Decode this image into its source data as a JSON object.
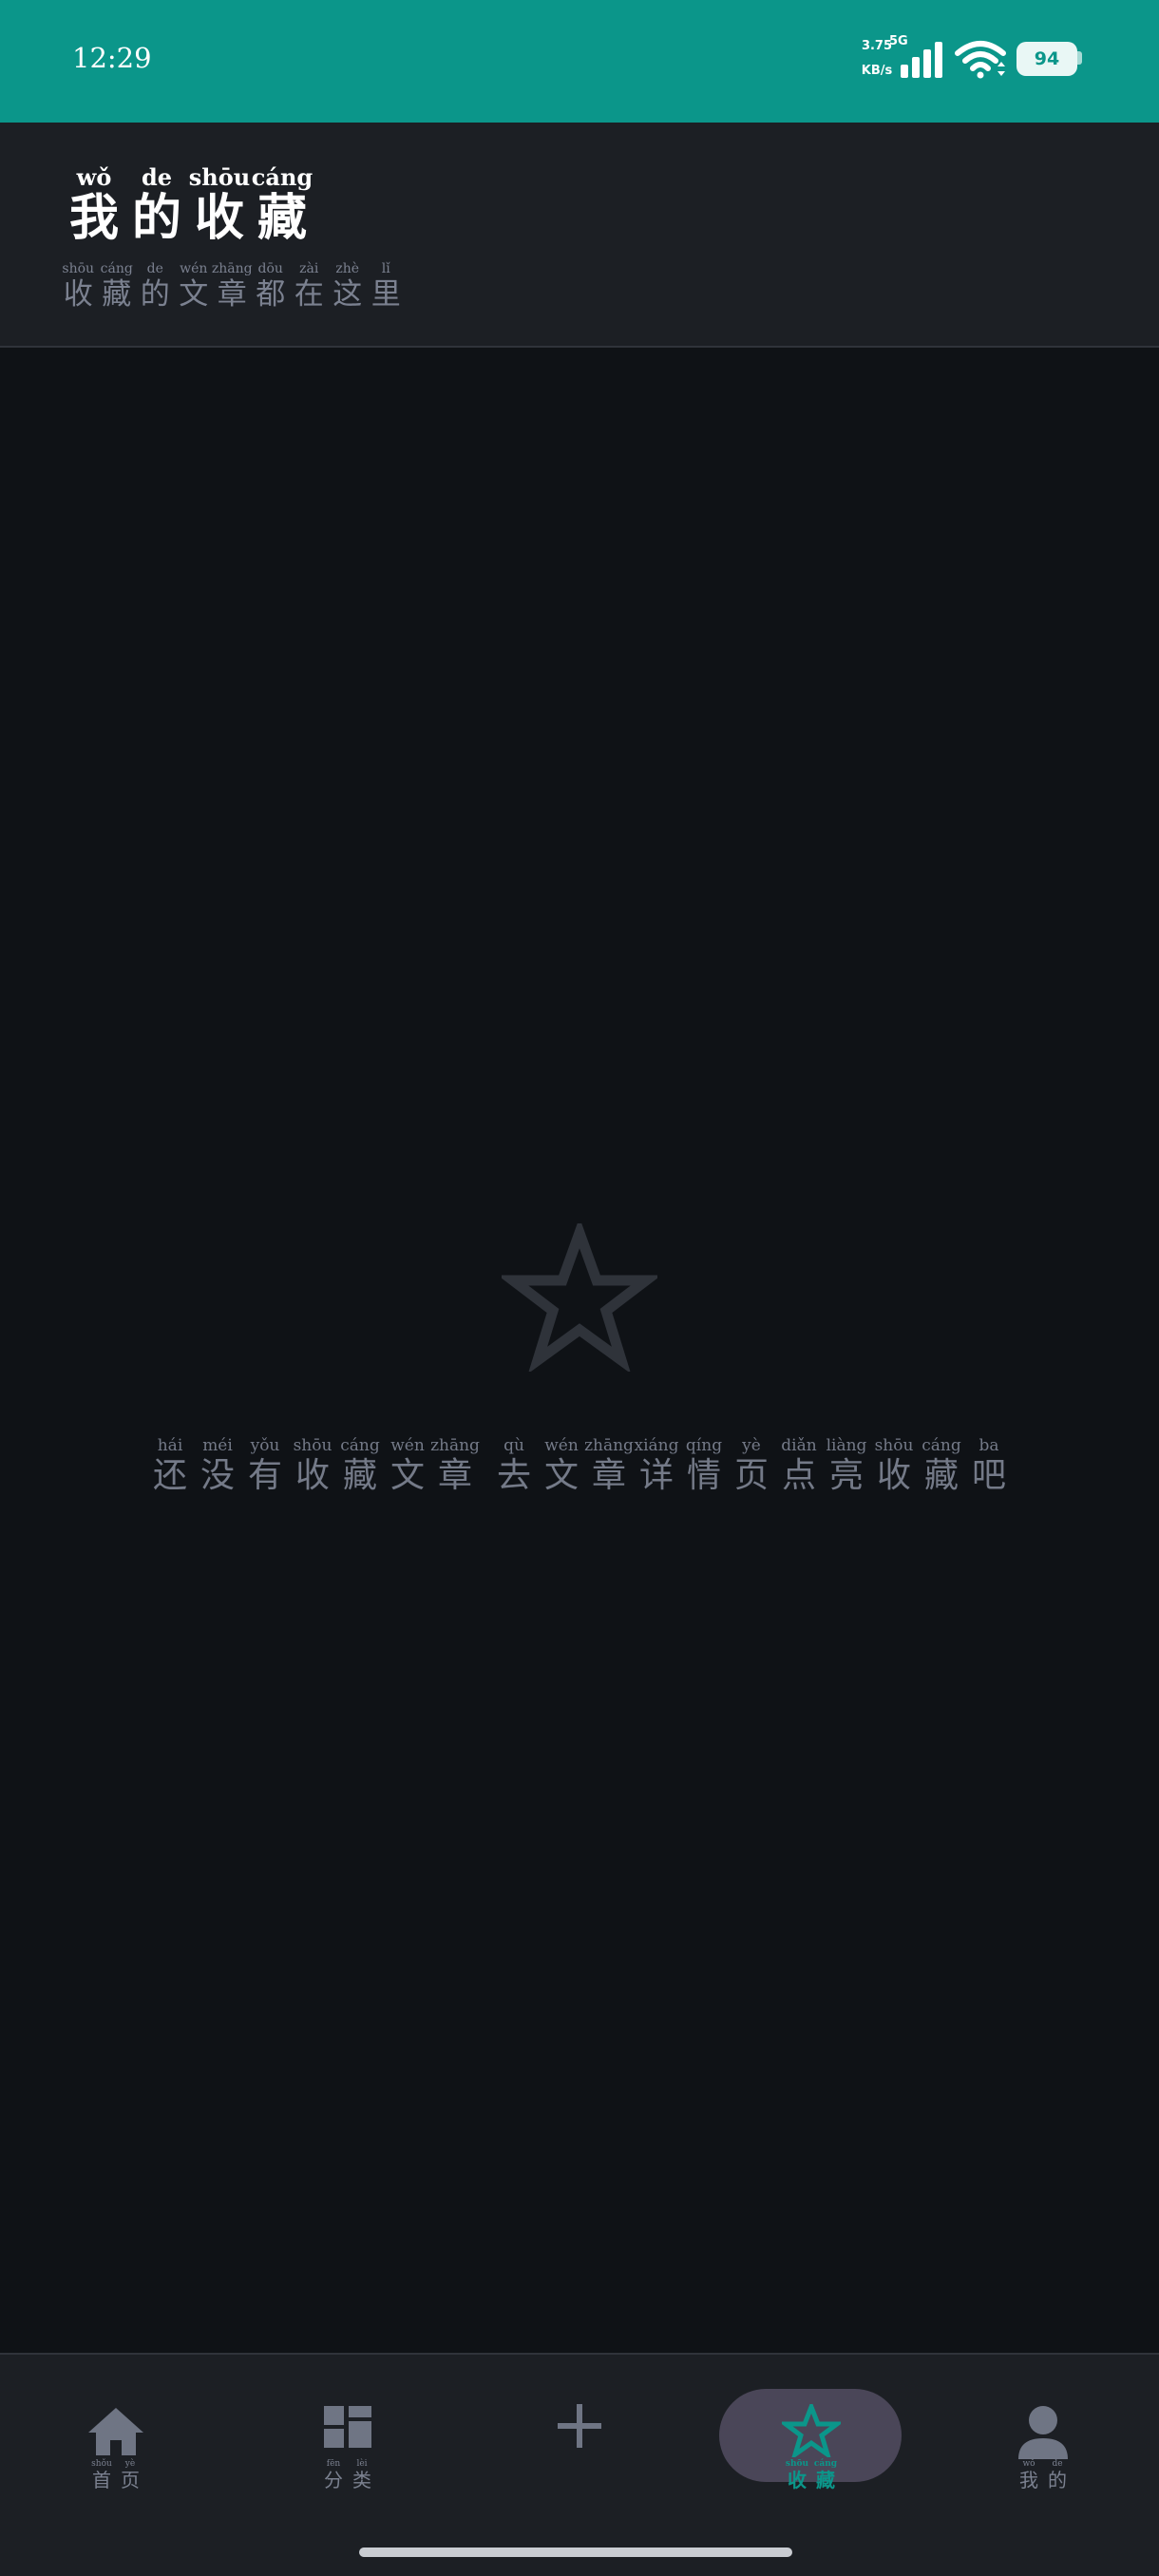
{
  "status_bar": {
    "time": "12:29",
    "net_speed_value": "3.75",
    "net_speed_unit": "KB/s",
    "network_type": "5G",
    "battery": "94",
    "color": "#0b968a"
  },
  "header": {
    "title": [
      {
        "py": "wǒ",
        "hz": "我"
      },
      {
        "py": "de",
        "hz": "的"
      },
      {
        "py": "shōu",
        "hz": "收"
      },
      {
        "py": "cáng",
        "hz": "藏"
      }
    ],
    "subtitle": [
      {
        "py": "shōu",
        "hz": "收"
      },
      {
        "py": "cáng",
        "hz": "藏"
      },
      {
        "py": "de",
        "hz": "的"
      },
      {
        "py": "wén",
        "hz": "文"
      },
      {
        "py": "zhāng",
        "hz": "章"
      },
      {
        "py": "dōu",
        "hz": "都"
      },
      {
        "py": "zài",
        "hz": "在"
      },
      {
        "py": "zhè",
        "hz": "这"
      },
      {
        "py": "lǐ",
        "hz": "里"
      }
    ]
  },
  "empty_state": {
    "icon": "star-outline-icon",
    "message": [
      {
        "py": "hái",
        "hz": "还"
      },
      {
        "py": "méi",
        "hz": "没"
      },
      {
        "py": "yǒu",
        "hz": "有"
      },
      {
        "py": "shōu",
        "hz": "收"
      },
      {
        "py": "cáng",
        "hz": "藏"
      },
      {
        "py": "wén",
        "hz": "文"
      },
      {
        "py": "zhāng",
        "hz": "章"
      },
      {
        "py": "",
        "hz": ""
      },
      {
        "py": "qù",
        "hz": "去"
      },
      {
        "py": "wén",
        "hz": "文"
      },
      {
        "py": "zhāng",
        "hz": "章"
      },
      {
        "py": "xiáng",
        "hz": "详"
      },
      {
        "py": "qíng",
        "hz": "情"
      },
      {
        "py": "yè",
        "hz": "页"
      },
      {
        "py": "diǎn",
        "hz": "点"
      },
      {
        "py": "liàng",
        "hz": "亮"
      },
      {
        "py": "shōu",
        "hz": "收"
      },
      {
        "py": "cáng",
        "hz": "藏"
      },
      {
        "py": "ba",
        "hz": "吧"
      }
    ]
  },
  "bottom_nav": {
    "active_color": "#0b968a",
    "items": [
      {
        "icon": "home-icon",
        "label": [
          {
            "py": "shǒu",
            "hz": "首"
          },
          {
            "py": "yè",
            "hz": "页"
          }
        ]
      },
      {
        "icon": "category-icon",
        "label": [
          {
            "py": "fēn",
            "hz": "分"
          },
          {
            "py": "lèi",
            "hz": "类"
          }
        ]
      },
      {
        "icon": "plus-icon",
        "label": []
      },
      {
        "icon": "star-icon",
        "label": [
          {
            "py": "shōu",
            "hz": "收"
          },
          {
            "py": "cáng",
            "hz": "藏"
          }
        ]
      },
      {
        "icon": "user-icon",
        "label": [
          {
            "py": "wǒ",
            "hz": "我"
          },
          {
            "py": "de",
            "hz": "的"
          }
        ]
      }
    ]
  }
}
